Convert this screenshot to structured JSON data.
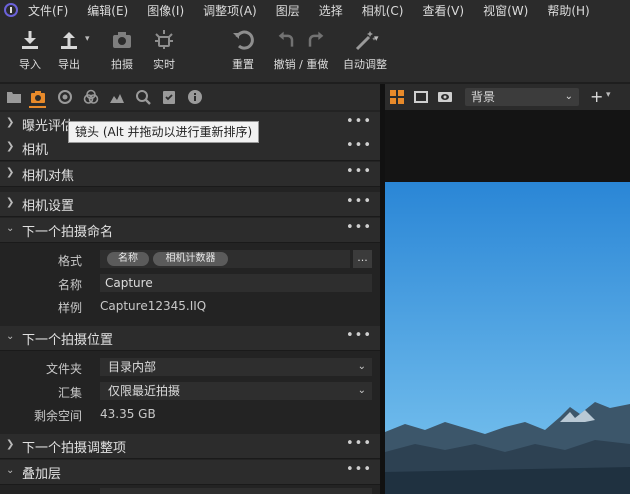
{
  "menu": [
    "文件(F)",
    "编辑(E)",
    "图像(I)",
    "调整项(A)",
    "图层",
    "选择",
    "相机(C)",
    "查看(V)",
    "视窗(W)",
    "帮助(H)"
  ],
  "toolbar": {
    "import_label": "导入",
    "export_label": "导出",
    "capture_label": "拍摄",
    "live_label": "实时",
    "reset_label": "重置",
    "undo_redo_label": "撤销 / 重做",
    "auto_adjust_label": "自动调整"
  },
  "right_top": {
    "background_select": "背景",
    "plus": "+"
  },
  "tooltip": "镜头 (Alt 并拖动以进行重新排序)",
  "sections": {
    "exposure": "曝光评估",
    "camera": "相机",
    "focus": "相机对焦",
    "settings": "相机设置",
    "naming": "下一个拍摄命名",
    "location": "下一个拍摄位置",
    "adjustments": "下一个拍摄调整项",
    "overlay": "叠加层",
    "more": "•••"
  },
  "naming": {
    "format_label": "格式",
    "tokens": [
      "名称",
      "相机计数器"
    ],
    "dots": "...",
    "name_label": "名称",
    "name_value": "Capture",
    "sample_label": "样例",
    "sample_value": "Capture12345.IIQ"
  },
  "location": {
    "folder_label": "文件夹",
    "folder_value": "目录内部",
    "collection_label": "汇集",
    "collection_value": "仅限最近拍摄",
    "space_label": "剩余空间",
    "space_value": "43.35 GB"
  },
  "colors": {
    "accent": "#e88a2a",
    "logo": "#6b62d9",
    "panel": "#2c2c2c",
    "sky": "#3aa0e6"
  }
}
